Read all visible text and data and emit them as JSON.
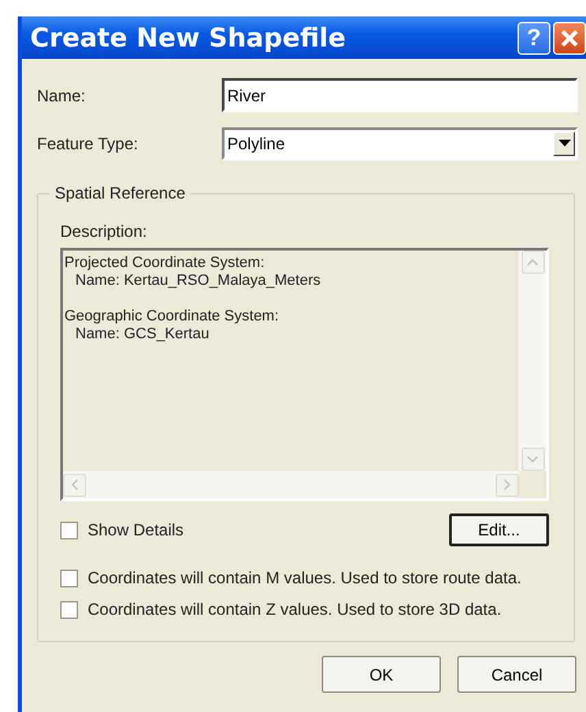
{
  "window": {
    "title": "Create New Shapefile",
    "title_buttons": [
      "?"
    ]
  },
  "name_field": {
    "label": "Name:",
    "value": "River"
  },
  "feature_type": {
    "label": "Feature Type:",
    "value": "Polyline"
  },
  "spatial_reference": {
    "title": "Spatial Reference",
    "description_label": "Description:",
    "description_sections": [
      {
        "heading": "Projected Coordinate System:",
        "detail": "Name: Kertau_RSO_Malaya_Meters"
      },
      {
        "heading": "Geographic Coordinate System:",
        "detail": "Name: GCS_Kertau"
      }
    ],
    "show_details": {
      "label": "Show Details",
      "checked": false
    },
    "edit_button": "Edit..."
  },
  "options": [
    {
      "label": "Coordinates will contain M values. Used to store route data.",
      "checked": false
    },
    {
      "label": "Coordinates will contain Z values. Used to store 3D data.",
      "checked": false
    }
  ],
  "buttons": [
    "OK",
    "Cancel"
  ]
}
